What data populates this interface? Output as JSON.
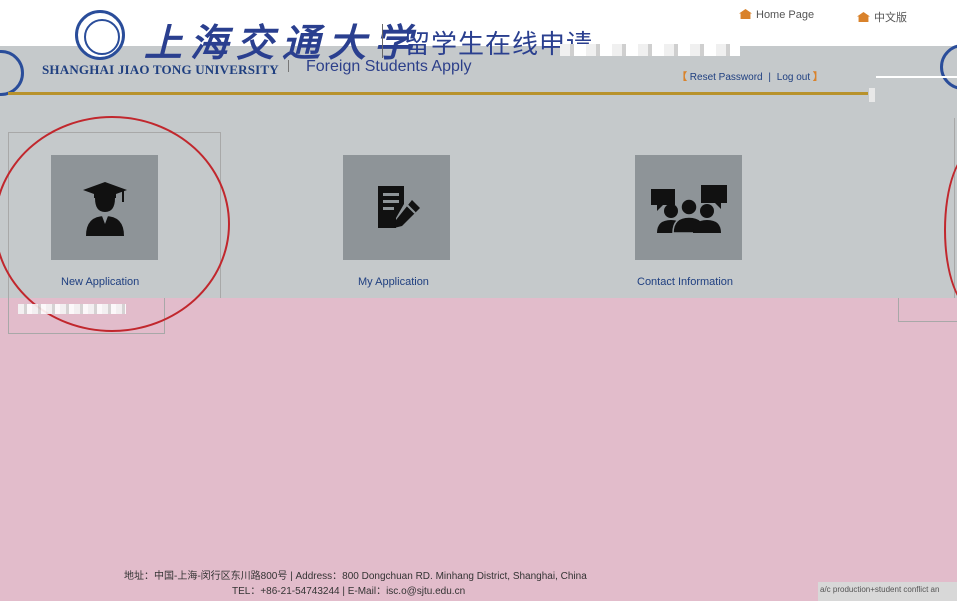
{
  "header": {
    "brand_cn": "上海交通大学",
    "brand_en": "SHANGHAI JIAO TONG UNIVERSITY",
    "subtitle_cn": "留学生在线申请",
    "subtitle_en": "Foreign Students Apply",
    "home_link": "Home Page",
    "lang_link": "中文版"
  },
  "account": {
    "open": "【",
    "reset_password": "Reset Password",
    "divider": "|",
    "log_out": "Log out",
    "close": "】"
  },
  "tiles": [
    {
      "label": "New Application",
      "icon": "graduate-icon"
    },
    {
      "label": "My Application",
      "icon": "document-edit-icon"
    },
    {
      "label": "Contact Information",
      "icon": "people-chat-icon"
    }
  ],
  "footer": {
    "line1": "地址：中国-上海-闵行区东川路800号  |  Address：800 Dongchuan RD. Minhang District, Shanghai, China",
    "line2": "TEL：+86-21-54743244  |  E-Mail：isc.o@sjtu.edu.cn"
  },
  "corner_text": "a/c production+student conflict an",
  "colors": {
    "background": "#e2bccb",
    "band": "#c5c9cb",
    "tile": "#8e9498",
    "brand_blue": "#2a3f8f",
    "gold": "#b8922c",
    "annotation_red": "#c1272d"
  }
}
